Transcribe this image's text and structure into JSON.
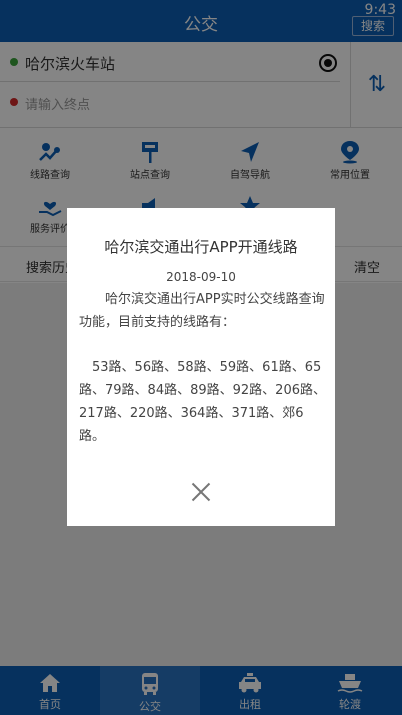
{
  "status_bar": {
    "time": "9:43"
  },
  "header": {
    "title": "公交",
    "search_label": "搜索"
  },
  "route_input": {
    "start": "哈尔滨火车站",
    "end_placeholder": "请输入终点"
  },
  "features": [
    {
      "label": "线路查询",
      "icon": "route-search-icon"
    },
    {
      "label": "站点查询",
      "icon": "bus-stop-icon"
    },
    {
      "label": "自驾导航",
      "icon": "navigation-arrow-icon"
    },
    {
      "label": "常用位置",
      "icon": "location-pin-icon"
    },
    {
      "label": "服务评价",
      "icon": "hand-heart-icon"
    },
    {
      "label": "",
      "icon": "announcement-icon"
    },
    {
      "label": "",
      "icon": "star-icon"
    }
  ],
  "history": {
    "title": "搜索历史",
    "clear_label": "清空"
  },
  "dialog": {
    "title": "哈尔滨交通出行APP开通线路",
    "date": "2018-09-10",
    "intro": "哈尔滨交通出行APP实时公交线路查询功能，目前支持的线路有：",
    "routes": "53路、56路、58路、59路、61路、65路、79路、84路、89路、92路、206路、217路、220路、364路、371路、郊6路。"
  },
  "bottom_nav": [
    {
      "label": "首页",
      "icon": "home-icon"
    },
    {
      "label": "公交",
      "icon": "bus-icon"
    },
    {
      "label": "出租",
      "icon": "taxi-icon"
    },
    {
      "label": "轮渡",
      "icon": "ferry-icon"
    }
  ],
  "colors": {
    "primary": "#0d5fb4",
    "start_dot": "#3aa33a",
    "end_dot": "#d42a2a"
  }
}
